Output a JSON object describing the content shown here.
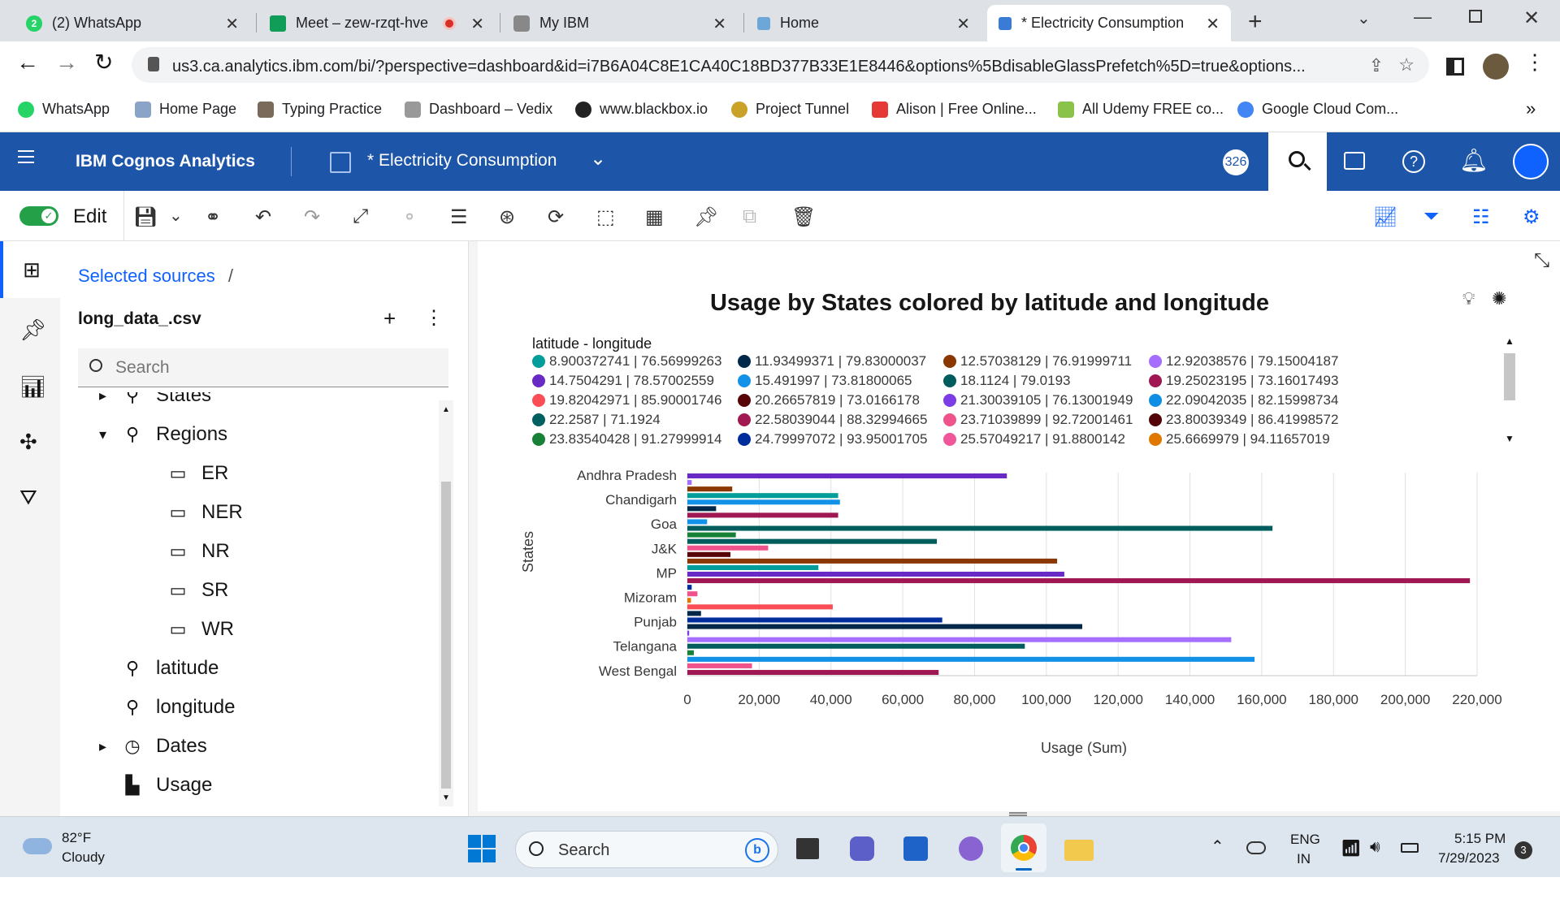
{
  "browser": {
    "tabs": [
      {
        "title": "(2) WhatsApp",
        "color": "#25d366"
      },
      {
        "title": "Meet – zew-rzqt-hve",
        "color": "#0f9d58"
      },
      {
        "title": "My IBM",
        "color": "#555555"
      },
      {
        "title": "Home",
        "color": "#6ea6d8"
      },
      {
        "title": "* Electricity Consumption",
        "color": "#3a7bd5"
      }
    ],
    "url": "us3.ca.analytics.ibm.com/bi/?perspective=dashboard&id=i7B6A04C8E1CA40C18BD377B33E1E8446&options%5BdisableGlassPrefetch%5D=true&options...",
    "bookmarks": [
      {
        "label": "WhatsApp",
        "color": "#25d366"
      },
      {
        "label": "Home Page",
        "color": "#8aa4c8"
      },
      {
        "label": "Typing Practice",
        "color": "#7a6a5a"
      },
      {
        "label": "Dashboard – Vedix",
        "color": "#999999"
      },
      {
        "label": "www.blackbox.io",
        "color": "#222222"
      },
      {
        "label": "Project Tunnel",
        "color": "#c9a227"
      },
      {
        "label": "Alison | Free Online...",
        "color": "#e53935"
      },
      {
        "label": "All Udemy FREE co...",
        "color": "#8bc34a"
      },
      {
        "label": "Google Cloud Com...",
        "color": "#4285f4"
      }
    ]
  },
  "app": {
    "product": "IBM Cognos Analytics",
    "dashboard_title": "* Electricity Consumption",
    "badge": "326"
  },
  "toolbar": {
    "edit_label": "Edit"
  },
  "panel": {
    "breadcrumb": "Selected sources",
    "breadcrumb_sep": "/",
    "source_name": "long_data_.csv",
    "search_placeholder": "Search",
    "tree": [
      {
        "label": "States",
        "kind": "geo",
        "level": 1,
        "caret": "right"
      },
      {
        "label": "Regions",
        "kind": "geo",
        "level": 1,
        "caret": "down"
      },
      {
        "label": "ER",
        "kind": "member",
        "level": 2
      },
      {
        "label": "NER",
        "kind": "member",
        "level": 2
      },
      {
        "label": "NR",
        "kind": "member",
        "level": 2
      },
      {
        "label": "SR",
        "kind": "member",
        "level": 2
      },
      {
        "label": "WR",
        "kind": "member",
        "level": 2
      },
      {
        "label": "latitude",
        "kind": "geo",
        "level": 1
      },
      {
        "label": "longitude",
        "kind": "geo",
        "level": 1
      },
      {
        "label": "Dates",
        "kind": "time",
        "level": 1,
        "caret": "right"
      },
      {
        "label": "Usage",
        "kind": "measure",
        "level": 1
      }
    ]
  },
  "chart_data": {
    "type": "bar",
    "orientation": "horizontal",
    "title": "Usage by States colored by latitude and longitude",
    "xlabel": "Usage (Sum)",
    "ylabel": "States",
    "xlim": [
      0,
      220000
    ],
    "xticks": [
      0,
      20000,
      40000,
      60000,
      80000,
      100000,
      120000,
      140000,
      160000,
      180000,
      200000,
      220000
    ],
    "xtick_labels": [
      "0",
      "20,000",
      "40,000",
      "60,000",
      "80,000",
      "100,000",
      "120,000",
      "140,000",
      "160,000",
      "180,000",
      "200,000",
      "220,000"
    ],
    "grid": true,
    "legend_title": "latitude - longitude",
    "legend_placement": "top",
    "legend": [
      {
        "label": "8.900372741 | 76.56999263",
        "color": "#009d9a"
      },
      {
        "label": "11.93499371 | 79.83000037",
        "color": "#012749"
      },
      {
        "label": "12.57038129 | 76.91999711",
        "color": "#8a3800"
      },
      {
        "label": "12.92038576 | 79.15004187",
        "color": "#a56eff"
      },
      {
        "label": "14.7504291 | 78.57002559",
        "color": "#6929c4"
      },
      {
        "label": "15.491997 | 73.81800065",
        "color": "#1192e8"
      },
      {
        "label": "18.1124 | 79.0193",
        "color": "#005d5d"
      },
      {
        "label": "19.25023195 | 73.16017493",
        "color": "#9f1853"
      },
      {
        "label": "19.82042971 | 85.90001746",
        "color": "#fa4d56"
      },
      {
        "label": "20.26657819 | 73.0166178",
        "color": "#570408"
      },
      {
        "label": "21.30039105 | 76.13001949",
        "color": "#7c3ce6"
      },
      {
        "label": "22.09042035 | 82.15998734",
        "color": "#0f8fe3"
      },
      {
        "label": "22.2587 | 71.1924",
        "color": "#00605f"
      },
      {
        "label": "22.58039044 | 88.32994665",
        "color": "#a11950"
      },
      {
        "label": "23.71039899 | 92.72001461",
        "color": "#ee538b"
      },
      {
        "label": "23.80039349 | 86.41998572",
        "color": "#520408"
      },
      {
        "label": "23.83540428 | 91.27999914",
        "color": "#198038"
      },
      {
        "label": "24.79997072 | 93.95001705",
        "color": "#002d9c"
      },
      {
        "label": "25.57049217 | 91.8800142",
        "color": "#f0579b"
      },
      {
        "label": "25.6669979 | 94.11657019",
        "color": "#e07800"
      }
    ],
    "state_labels": [
      "Andhra Pradesh",
      "Chandigarh",
      "Goa",
      "J&K",
      "MP",
      "Mizoram",
      "Punjab",
      "Telangana",
      "West Bengal"
    ],
    "bars": [
      {
        "value": 89000,
        "color": "#6929c4"
      },
      {
        "value": 1200,
        "color": "#a56eff"
      },
      {
        "value": 12500,
        "color": "#8a3800"
      },
      {
        "value": 42000,
        "color": "#009d9a"
      },
      {
        "value": 42500,
        "color": "#1192e8"
      },
      {
        "value": 8000,
        "color": "#012749"
      },
      {
        "value": 42000,
        "color": "#9f1853"
      },
      {
        "value": 5500,
        "color": "#1192e8"
      },
      {
        "value": 163000,
        "color": "#005d5d"
      },
      {
        "value": 13500,
        "color": "#198038"
      },
      {
        "value": 69500,
        "color": "#005d5d"
      },
      {
        "value": 22500,
        "color": "#ee538b"
      },
      {
        "value": 12000,
        "color": "#570408"
      },
      {
        "value": 103000,
        "color": "#8a3800"
      },
      {
        "value": 36500,
        "color": "#009d9a"
      },
      {
        "value": 105000,
        "color": "#6929c4"
      },
      {
        "value": 218000,
        "color": "#9f1853"
      },
      {
        "value": 1200,
        "color": "#002d9c"
      },
      {
        "value": 2800,
        "color": "#ee538b"
      },
      {
        "value": 1000,
        "color": "#e07800"
      },
      {
        "value": 40500,
        "color": "#fa4d56"
      },
      {
        "value": 3800,
        "color": "#012749"
      },
      {
        "value": 71000,
        "color": "#002d9c"
      },
      {
        "value": 110000,
        "color": "#012749"
      },
      {
        "value": 500,
        "color": "#7c3ce6"
      },
      {
        "value": 151500,
        "color": "#a56eff"
      },
      {
        "value": 94000,
        "color": "#005d5d"
      },
      {
        "value": 1800,
        "color": "#198038"
      },
      {
        "value": 158000,
        "color": "#1192e8"
      },
      {
        "value": 18000,
        "color": "#ee538b"
      },
      {
        "value": 70000,
        "color": "#9f1853"
      }
    ]
  },
  "taskbar": {
    "temp": "82°F",
    "weather": "Cloudy",
    "search": "Search",
    "lang1": "ENG",
    "lang2": "IN",
    "time": "5:15 PM",
    "date": "7/29/2023",
    "notif": "3"
  }
}
